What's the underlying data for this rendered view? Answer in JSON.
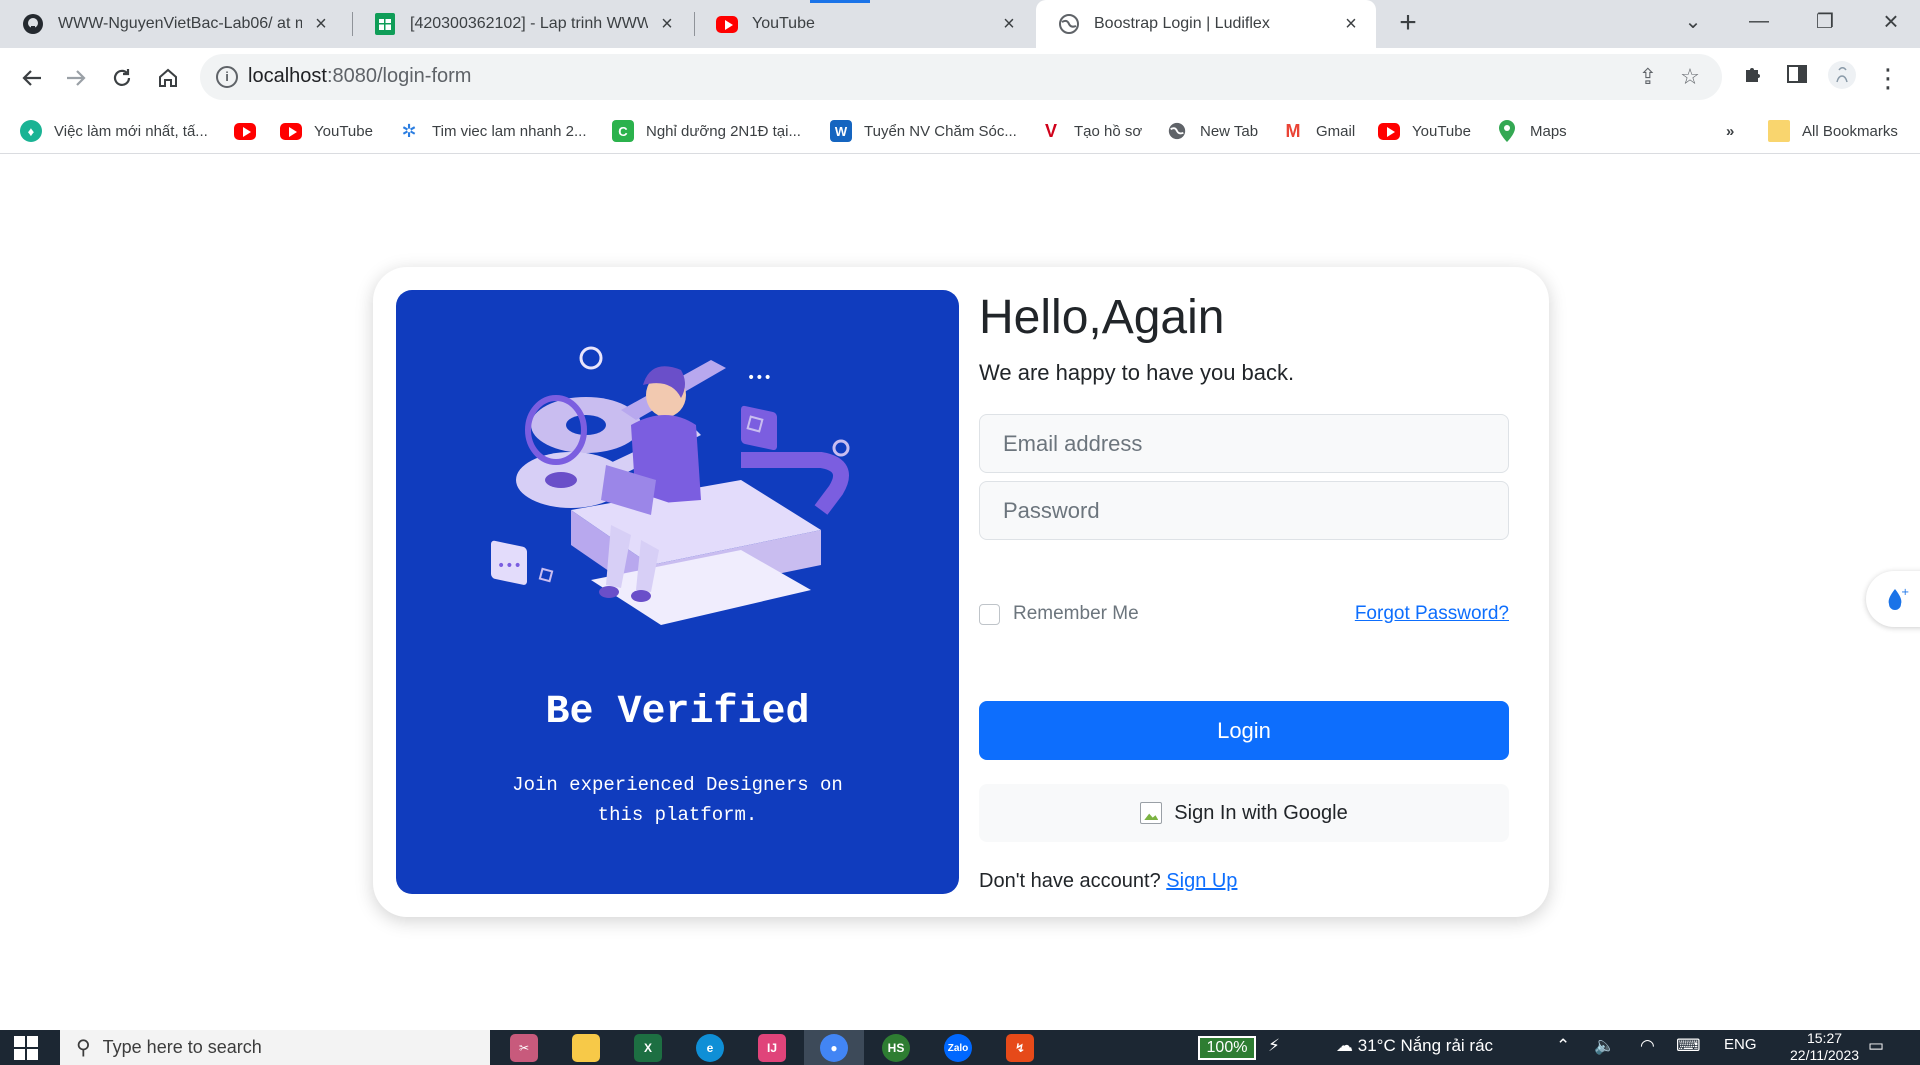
{
  "browser": {
    "tabs": [
      {
        "title": "WWW-NguyenVietBac-Lab06/ at m",
        "icon": "github-icon"
      },
      {
        "title": "[420300362102] - Lap trinh WWW (",
        "icon": "sheets-icon"
      },
      {
        "title": "YouTube",
        "icon": "youtube-icon"
      },
      {
        "title": "Boostrap Login | Ludiflex",
        "icon": "globe-icon",
        "active": true
      }
    ],
    "url_host": "localhost",
    "url_path": ":8080/login-form",
    "bookmarks": [
      {
        "label": "Việc làm mới nhất, tấ...",
        "icon": "jobs-icon"
      },
      {
        "label": "",
        "icon": "youtube-icon"
      },
      {
        "label": "YouTube",
        "icon": "youtube-icon"
      },
      {
        "label": "Tim viec lam nhanh 2...",
        "icon": "star-icon"
      },
      {
        "label": "Nghỉ dưỡng 2N1Đ tại...",
        "icon": "c-icon"
      },
      {
        "label": "Tuyển NV Chăm Sóc...",
        "icon": "w-icon"
      },
      {
        "label": "Tạo hồ sơ",
        "icon": "v-icon"
      },
      {
        "label": "New Tab",
        "icon": "globe-icon"
      },
      {
        "label": "Gmail",
        "icon": "gmail-icon"
      },
      {
        "label": "YouTube",
        "icon": "youtube-icon"
      },
      {
        "label": "Maps",
        "icon": "maps-icon"
      }
    ],
    "bookmarks_overflow": "»",
    "all_bookmarks": "All Bookmarks"
  },
  "login": {
    "left": {
      "title": "Be Verified",
      "subtitle": "Join experienced Designers on this platform."
    },
    "heading": "Hello,Again",
    "subheading": "We are happy to have you back.",
    "email_placeholder": "Email address",
    "password_placeholder": "Password",
    "remember_label": "Remember Me",
    "forgot_label": "Forgot Password?",
    "login_label": "Login",
    "google_label": "Sign In with Google",
    "no_account_text": "Don't have account?",
    "signup_label": "Sign Up"
  },
  "taskbar": {
    "search_placeholder": "Type here to search",
    "battery": "100%",
    "weather": "31°C  Nắng rải rác",
    "language": "ENG",
    "time": "15:27",
    "date": "22/11/2023"
  },
  "colors": {
    "panel_blue": "#103cbe",
    "primary": "#0d6efd"
  }
}
